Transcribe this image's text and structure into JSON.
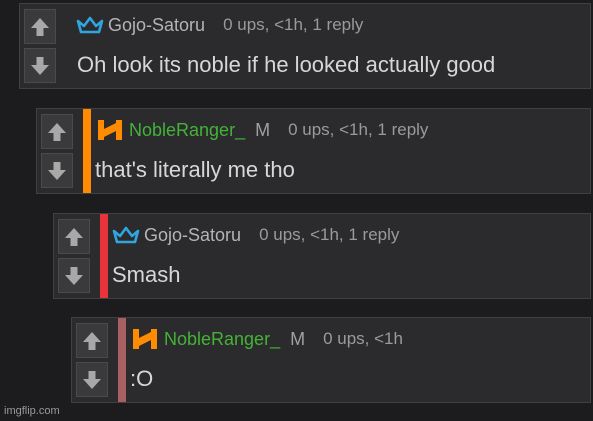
{
  "comments": [
    {
      "username": "Gojo-Satoru",
      "user_icon": "crown-icon",
      "moderator_badge": "",
      "meta": "0 ups, <1h, 1 reply",
      "body": "Oh look its noble if he looked actually good",
      "thread_color": ""
    },
    {
      "username": "NobleRanger_",
      "user_icon": "noble-logo-icon",
      "moderator_badge": "M",
      "meta": "0 ups, <1h, 1 reply",
      "body": "that's literally me tho",
      "thread_color": "#ff8c00"
    },
    {
      "username": "Gojo-Satoru",
      "user_icon": "crown-icon",
      "moderator_badge": "",
      "meta": "0 ups, <1h, 1 reply",
      "body": "Smash",
      "thread_color": "#e8333a"
    },
    {
      "username": "NobleRanger_",
      "user_icon": "noble-logo-icon",
      "moderator_badge": "M",
      "meta": "0 ups, <1h",
      "body": ":O",
      "thread_color": "#a86060"
    }
  ],
  "watermark": "imgflip.com",
  "colors": {
    "background": "#1c1c1e",
    "panel": "#2b2b2d",
    "gojo_name": "#b4b4b4",
    "noble_name": "#43b336",
    "crown": "#2fa6e0",
    "noble_logo": "#ff8c00"
  }
}
